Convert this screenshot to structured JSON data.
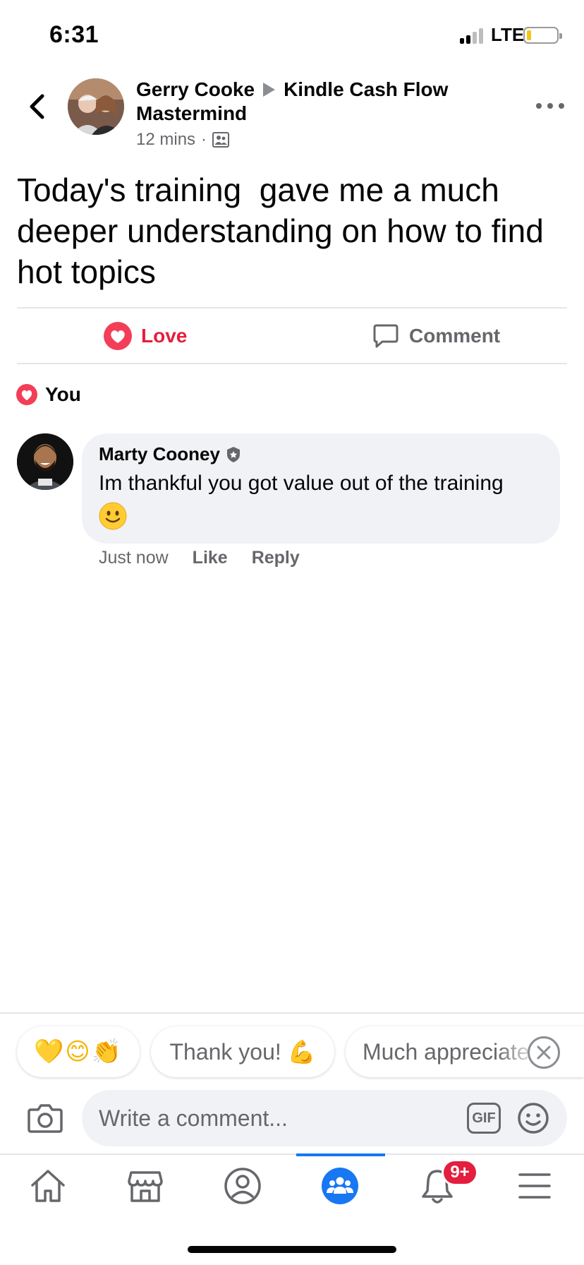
{
  "status_bar": {
    "time": "6:31",
    "network": "LTE",
    "battery_color": "#f5c518"
  },
  "post": {
    "author": "Gerry Cooke",
    "group": "Kindle Cash Flow Mastermind",
    "time": "12 mins",
    "separator": "·",
    "privacy_icon": "group-privacy-icon",
    "text": "Today's training  gave me a much deeper understanding on how to find hot topics"
  },
  "actions": {
    "love_label": "Love",
    "comment_label": "Comment",
    "love_color": "#e41e3f"
  },
  "reactions": {
    "summary": "You"
  },
  "comment": {
    "author": "Marty Cooney",
    "text": "Im thankful you got value out of the training",
    "emoji": "🙂",
    "time": "Just now",
    "like_label": "Like",
    "reply_label": "Reply"
  },
  "quick_replies": [
    {
      "label": "💛😊👏"
    },
    {
      "label": "Thank you! 💪"
    },
    {
      "label": "Much appreciated"
    }
  ],
  "composer": {
    "placeholder": "Write a comment...",
    "gif_label": "GIF"
  },
  "tabbar": {
    "tabs": [
      "home",
      "marketplace",
      "profile",
      "groups",
      "notifications",
      "menu"
    ],
    "active": "groups",
    "notifications_badge": "9+",
    "accent": "#1877f2"
  }
}
